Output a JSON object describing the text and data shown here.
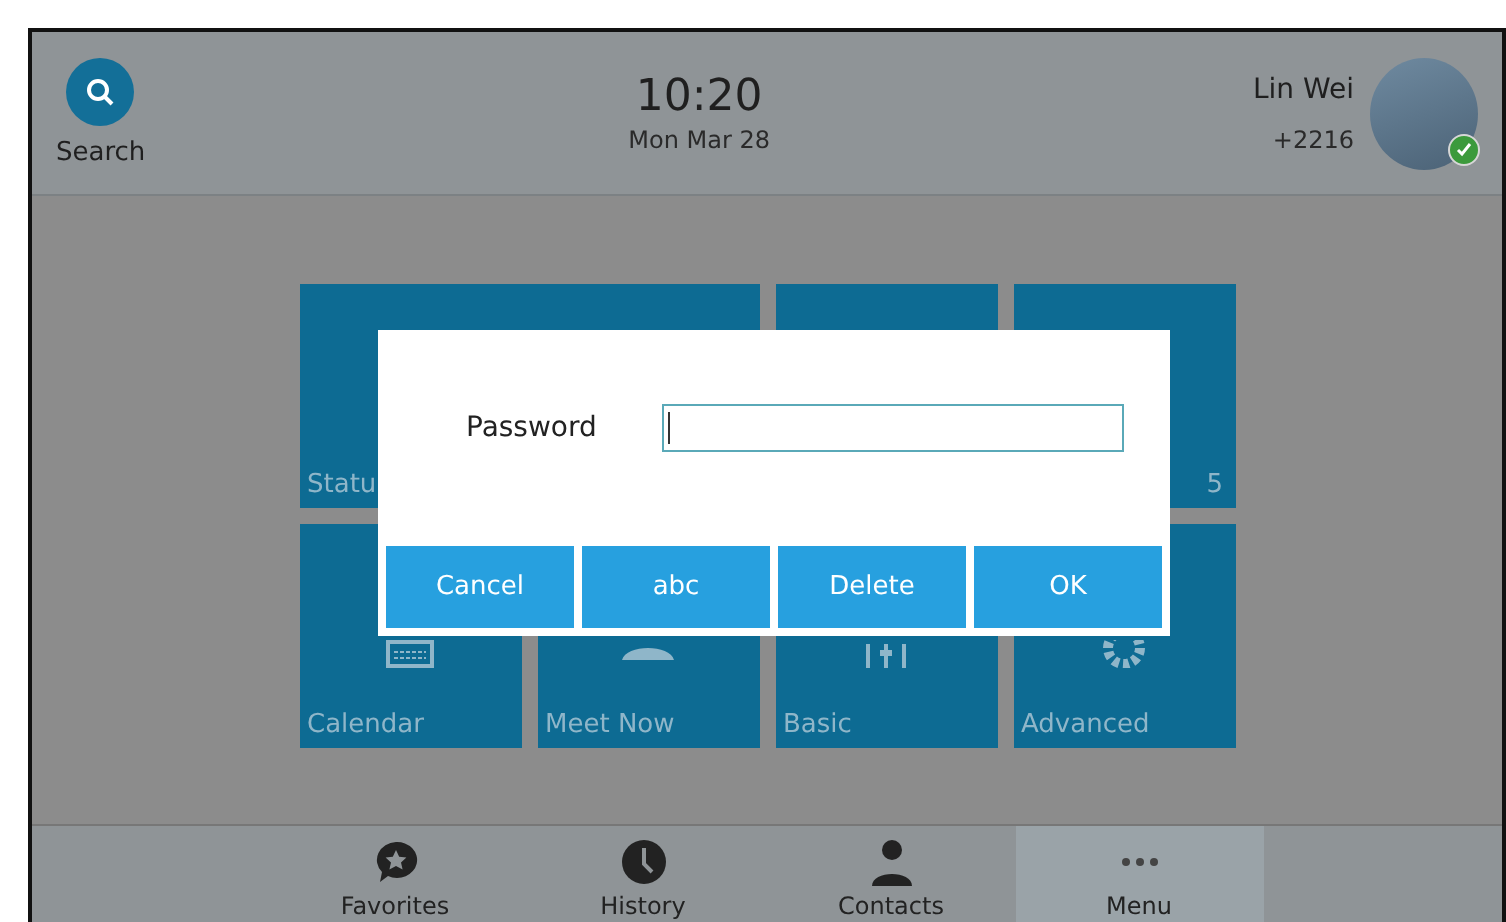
{
  "header": {
    "search": {
      "label": "Search"
    },
    "clock": {
      "time": "10:20",
      "date": "Mon Mar 28"
    },
    "user": {
      "name": "Lin Wei",
      "extension": "+2216",
      "online": true
    }
  },
  "tiles": [
    {
      "label": "Statu",
      "wide": true
    },
    {
      "wide": false
    },
    {
      "label": "5",
      "wide": false
    },
    {
      "label": "Calendar",
      "wide": false
    },
    {
      "label": "Meet Now",
      "wide": false
    },
    {
      "label": "Basic",
      "wide": false
    },
    {
      "label": "Advanced",
      "wide": false
    }
  ],
  "dialog": {
    "field_label": "Password",
    "focused": true,
    "buttons": [
      "Cancel",
      "abc",
      "Delete",
      "OK"
    ]
  },
  "nav": [
    {
      "label": "Favorites",
      "selected": false
    },
    {
      "label": "History",
      "selected": false
    },
    {
      "label": "Contacts",
      "selected": false
    },
    {
      "label": "Menu",
      "selected": true
    }
  ]
}
